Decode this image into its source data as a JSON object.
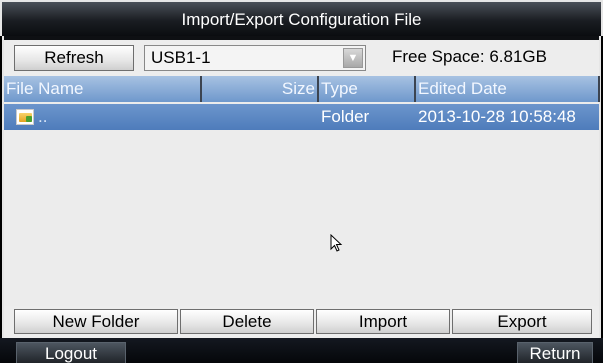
{
  "dialog": {
    "title": "Import/Export Configuration File"
  },
  "toolbar": {
    "refresh_label": "Refresh",
    "device_select": {
      "selected": "USB1-1"
    },
    "free_space": "Free Space: 6.81GB"
  },
  "table": {
    "columns": [
      "File Name",
      "Size",
      "Type",
      "Edited Date"
    ],
    "rows": [
      {
        "name": "..",
        "size": "",
        "type": "Folder",
        "edited": "2013-10-28 10:58:48",
        "icon": "folder-icon",
        "selected": true
      }
    ]
  },
  "actions": {
    "new_folder": "New Folder",
    "delete": "Delete",
    "import": "Import",
    "export": "Export"
  },
  "footer": {
    "logout": "Logout",
    "return": "Return"
  },
  "colors": {
    "header_blue": "#6f98cc",
    "selected_row": "#4e7cbb",
    "title_bg": "#1a1d22"
  }
}
